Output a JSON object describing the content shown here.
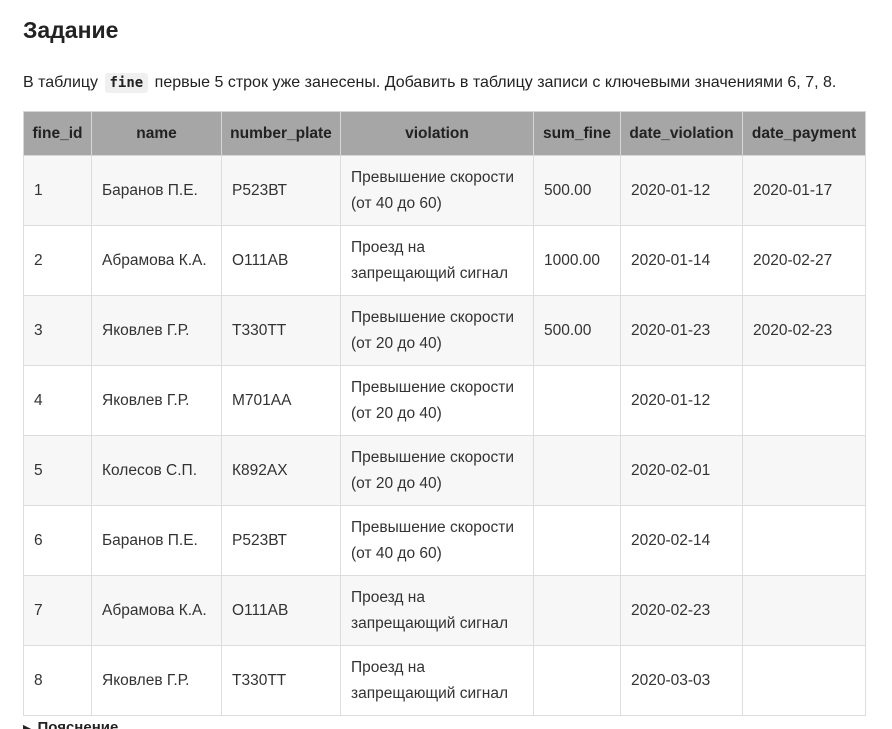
{
  "title": "Задание",
  "intro": {
    "before": "В таблицу",
    "code": "fine",
    "after": "первые 5 строк уже занесены. Добавить в таблицу записи с ключевыми значениями 6, 7, 8."
  },
  "table": {
    "headers": [
      "fine_id",
      "name",
      "number_plate",
      "violation",
      "sum_fine",
      "date_violation",
      "date_payment"
    ],
    "rows": [
      [
        "1",
        "Баранов П.Е.",
        "Р523ВТ",
        "Превышение скорости (от 40 до 60)",
        "500.00",
        "2020-01-12",
        "2020-01-17"
      ],
      [
        "2",
        "Абрамова К.А.",
        "О111АВ",
        "Проезд на запрещающий сигнал",
        "1000.00",
        "2020-01-14",
        "2020-02-27"
      ],
      [
        "3",
        "Яковлев Г.Р.",
        "Т330ТТ",
        "Превышение скорости (от 20 до 40)",
        "500.00",
        "2020-01-23",
        "2020-02-23"
      ],
      [
        "4",
        "Яковлев Г.Р.",
        "М701АА",
        "Превышение скорости (от 20 до 40)",
        "",
        "2020-01-12",
        ""
      ],
      [
        "5",
        "Колесов С.П.",
        "К892АХ",
        "Превышение скорости (от 20 до 40)",
        "",
        "2020-02-01",
        ""
      ],
      [
        "6",
        "Баранов П.Е.",
        "Р523ВТ",
        "Превышение скорости (от 40 до 60)",
        "",
        "2020-02-14",
        ""
      ],
      [
        "7",
        "Абрамова К.А.",
        "О111АВ",
        "Проезд на запрещающий сигнал",
        "",
        "2020-02-23",
        ""
      ],
      [
        "8",
        "Яковлев Г.Р.",
        "Т330ТТ",
        "Проезд на запрещающий сигнал",
        "",
        "2020-03-03",
        ""
      ]
    ]
  },
  "details": {
    "label": "Пояснение",
    "icon": "triangle-right-icon"
  }
}
